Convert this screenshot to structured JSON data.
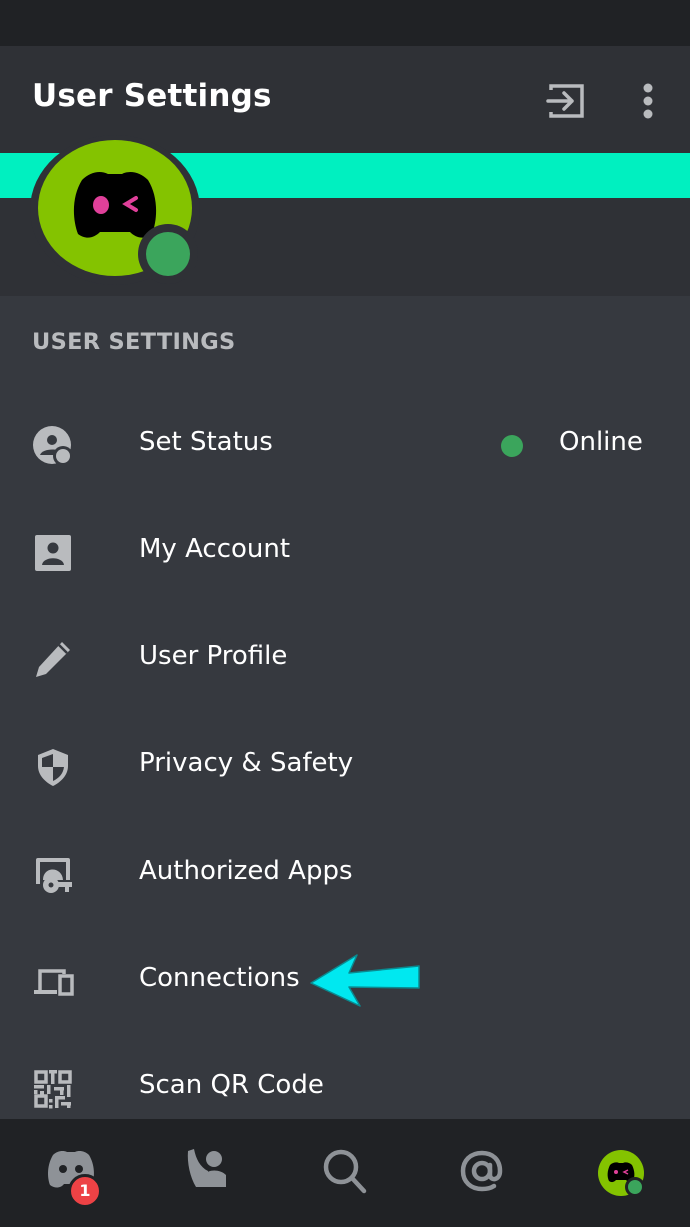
{
  "header": {
    "title": "User Settings",
    "exit_icon": "exit-icon",
    "more_icon": "more-vertical-icon"
  },
  "profile": {
    "banner_color": "#00f0c0",
    "avatar_color": "#84c300",
    "status": "online",
    "status_color": "#3ba55c"
  },
  "section": {
    "label": "USER SETTINGS"
  },
  "items": [
    {
      "label": "Set Status",
      "icon": "set-status-icon",
      "value": "Online"
    },
    {
      "label": "My Account",
      "icon": "account-icon"
    },
    {
      "label": "User Profile",
      "icon": "pencil-icon"
    },
    {
      "label": "Privacy & Safety",
      "icon": "shield-icon"
    },
    {
      "label": "Authorized Apps",
      "icon": "key-icon"
    },
    {
      "label": "Connections",
      "icon": "devices-icon"
    },
    {
      "label": "Scan QR Code",
      "icon": "qr-code-icon"
    }
  ],
  "annotation": {
    "arrow_color": "#00e5f0",
    "target": "Connections"
  },
  "bottom_nav": {
    "items": [
      {
        "name": "home",
        "icon": "discord-icon",
        "badge": "1"
      },
      {
        "name": "friends",
        "icon": "friends-icon"
      },
      {
        "name": "search",
        "icon": "search-icon"
      },
      {
        "name": "mentions",
        "icon": "at-icon"
      },
      {
        "name": "profile",
        "icon": "avatar"
      }
    ]
  }
}
